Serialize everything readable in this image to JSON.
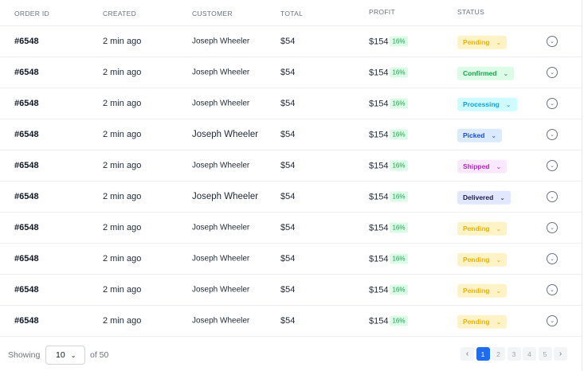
{
  "headers": {
    "order_id": "ORDER ID",
    "created": "CREATED",
    "customer": "CUSTOMER",
    "total": "TOTAL",
    "profit": "PROFIT",
    "status": "STATUS"
  },
  "rows": [
    {
      "order_id": "#6548",
      "created": "2 min ago",
      "customer": "Joseph Wheeler",
      "total": "$54",
      "profit": "$154",
      "profit_pct": "16%",
      "status": "Pending"
    },
    {
      "order_id": "#6548",
      "created": "2 min ago",
      "customer": "Joseph Wheeler",
      "total": "$54",
      "profit": "$154",
      "profit_pct": "16%",
      "status": "Confirmed"
    },
    {
      "order_id": "#6548",
      "created": "2 min ago",
      "customer": "Joseph Wheeler",
      "total": "$54",
      "profit": "$154",
      "profit_pct": "16%",
      "status": "Processing"
    },
    {
      "order_id": "#6548",
      "created": "2 min ago",
      "customer": "Joseph Wheeler",
      "total": "$54",
      "profit": "$154",
      "profit_pct": "16%",
      "status": "Picked"
    },
    {
      "order_id": "#6548",
      "created": "2 min ago",
      "customer": "Joseph Wheeler",
      "total": "$54",
      "profit": "$154",
      "profit_pct": "16%",
      "status": "Shipped"
    },
    {
      "order_id": "#6548",
      "created": "2 min ago",
      "customer": "Joseph Wheeler",
      "total": "$54",
      "profit": "$154",
      "profit_pct": "16%",
      "status": "Delivered"
    },
    {
      "order_id": "#6548",
      "created": "2 min ago",
      "customer": "Joseph Wheeler",
      "total": "$54",
      "profit": "$154",
      "profit_pct": "16%",
      "status": "Pending"
    },
    {
      "order_id": "#6548",
      "created": "2 min ago",
      "customer": "Joseph Wheeler",
      "total": "$54",
      "profit": "$154",
      "profit_pct": "16%",
      "status": "Pending"
    },
    {
      "order_id": "#6548",
      "created": "2 min ago",
      "customer": "Joseph Wheeler",
      "total": "$54",
      "profit": "$154",
      "profit_pct": "16%",
      "status": "Pending"
    },
    {
      "order_id": "#6548",
      "created": "2 min ago",
      "customer": "Joseph Wheeler",
      "total": "$54",
      "profit": "$154",
      "profit_pct": "16%",
      "status": "Pending"
    }
  ],
  "status_colors": {
    "Pending": {
      "bg": "#fef3c7",
      "fg": "#eab308"
    },
    "Confirmed": {
      "bg": "#dcfce7",
      "fg": "#16a34a"
    },
    "Processing": {
      "bg": "#cffafe",
      "fg": "#0ea5e9"
    },
    "Picked": {
      "bg": "#dbeafe",
      "fg": "#1d4ed8"
    },
    "Shipped": {
      "bg": "#fae8ff",
      "fg": "#c026d3"
    },
    "Delivered": {
      "bg": "#e0e7ff",
      "fg": "#1e1b4b"
    }
  },
  "footer": {
    "showing_label": "Showing",
    "page_size": "10",
    "of_label": "of 50",
    "pages": [
      "1",
      "2",
      "3",
      "4",
      "5"
    ],
    "active_page": "1",
    "prev_icon": "chevron-left-icon",
    "next_icon": "chevron-right-icon"
  },
  "icons": {
    "dropdown": "chevron-down-icon",
    "row_action": "chevron-down-circle-icon"
  }
}
